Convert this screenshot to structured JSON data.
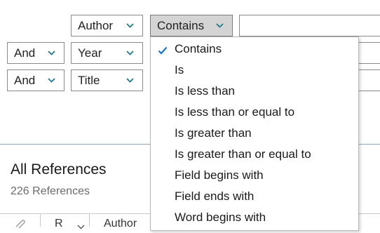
{
  "search": {
    "rows": [
      {
        "connector": null,
        "field": "Author",
        "operator": "Contains"
      },
      {
        "connector": "And",
        "field": "Year",
        "operator": ""
      },
      {
        "connector": "And",
        "field": "Title",
        "operator": ""
      }
    ]
  },
  "library": {
    "title": "All References",
    "count": "226 References",
    "columns": [
      "R",
      "Author"
    ]
  },
  "operator_menu": {
    "selected": "Contains",
    "items": [
      "Contains",
      "Is",
      "Is less than",
      "Is less than or equal to",
      "Is greater than",
      "Is greater than or equal to",
      "Field begins with",
      "Field ends with",
      "Word begins with"
    ]
  },
  "colors": {
    "accent": "#1f7a8c",
    "check": "#1a73c7"
  },
  "icons": {
    "dropdown": "chevron-down-icon",
    "check": "checkmark-icon",
    "attachment": "paperclip-icon"
  }
}
